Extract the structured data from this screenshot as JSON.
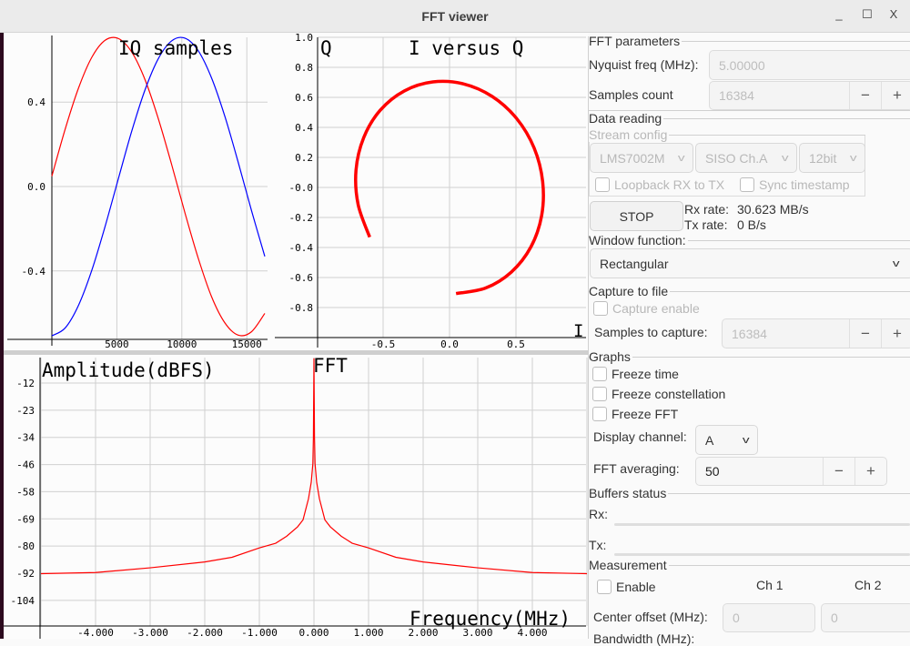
{
  "window": {
    "title": "FFT viewer",
    "minimize": "_",
    "maximize": "☐",
    "close": "X"
  },
  "colors": {
    "i_series": "#ff0000",
    "q_series": "#0000ff",
    "fft": "#ff0000",
    "grid": "#d0d0d0"
  },
  "chart_data": [
    {
      "type": "line",
      "title": "IQ samples",
      "xlabel": "",
      "ylabel": "",
      "xlim": [
        0,
        16384
      ],
      "ylim": [
        -0.72,
        0.71
      ],
      "xticks": [
        5000,
        10000,
        15000
      ],
      "xtick_labels": [
        "5000",
        "10000",
        "15000"
      ],
      "yticks": [
        0.4,
        0.0,
        -0.4
      ],
      "ytick_labels": [
        "0.4",
        "0.0",
        "-0.4"
      ],
      "grid": true,
      "x": [
        0,
        1024,
        2048,
        3072,
        4096,
        5120,
        6144,
        7168,
        8192,
        9216,
        10240,
        11264,
        12288,
        13312,
        14336,
        15360,
        16384
      ],
      "series": [
        {
          "name": "I",
          "color": "#ff0000",
          "values": [
            0.049,
            0.272,
            0.466,
            0.612,
            0.693,
            0.701,
            0.637,
            0.506,
            0.321,
            0.104,
            -0.125,
            -0.34,
            -0.522,
            -0.646,
            -0.704,
            -0.688,
            -0.601
          ]
        },
        {
          "name": "Q",
          "color": "#0000ff",
          "values": [
            -0.707,
            -0.67,
            -0.563,
            -0.397,
            -0.189,
            0.038,
            0.262,
            0.458,
            0.606,
            0.69,
            0.703,
            0.643,
            0.514,
            0.332,
            0.115,
            -0.114,
            -0.331
          ]
        }
      ]
    },
    {
      "type": "scatter",
      "title": "I versus Q",
      "xlabel": "I",
      "ylabel": "Q",
      "xlim": [
        -1.0,
        1.0
      ],
      "ylim": [
        -1.0,
        1.0
      ],
      "xticks": [
        -0.5,
        0.0,
        0.5
      ],
      "xtick_labels": [
        "-0.5",
        "0.0",
        "0.5"
      ],
      "yticks": [
        1.0,
        0.8,
        0.6,
        0.4,
        0.2,
        0.0,
        -0.2,
        -0.4,
        -0.6,
        -0.8
      ],
      "ytick_labels": [
        "1.0",
        "0.8",
        "0.6",
        "0.4",
        "0.2",
        "-0.0",
        "-0.2",
        "-0.4",
        "-0.6",
        "-0.8"
      ],
      "grid": true,
      "source": "IQ samples I/Q series"
    },
    {
      "type": "line",
      "title": "FFT",
      "xlabel": "Frequency(MHz)",
      "ylabel": "Amplitude(dBFS)",
      "xlim": [
        -5,
        5
      ],
      "ylim": [
        -116,
        0
      ],
      "xticks": [
        -4,
        -3,
        -2,
        -1,
        0,
        1,
        2,
        3,
        4
      ],
      "xtick_labels": [
        "-4.000",
        "-3.000",
        "-2.000",
        "-1.000",
        "0.000",
        "1.000",
        "2.000",
        "3.000",
        "4.000"
      ],
      "yticks": [
        -11.6,
        -23.2,
        -34.8,
        -46.4,
        -58,
        -69.6,
        -81.2,
        -92.8,
        -104.4
      ],
      "ytick_labels": [
        "-12",
        "-23",
        "-34",
        "-46",
        "-58",
        "-69",
        "-80",
        "-92",
        "-104"
      ],
      "grid": true,
      "x": [
        -5,
        -4,
        -3,
        -2,
        -1.5,
        -1,
        -0.7,
        -0.5,
        -0.3,
        -0.2,
        -0.1,
        -0.05,
        -0.02,
        -0.01,
        0,
        0.01,
        0.02,
        0.05,
        0.1,
        0.2,
        0.3,
        0.5,
        0.7,
        1,
        1.5,
        2,
        3,
        4,
        5
      ],
      "values": [
        -93,
        -92.5,
        -90.5,
        -88,
        -86,
        -82,
        -80,
        -77,
        -73,
        -70,
        -61,
        -54,
        -46,
        -35,
        -1,
        -35,
        -46,
        -54,
        -61,
        -70,
        -73,
        -77,
        -80,
        -82,
        -86,
        -88,
        -90.5,
        -92.5,
        -93
      ]
    }
  ],
  "panel": {
    "fft_params": {
      "title": "FFT parameters",
      "nyquist_label": "Nyquist freq (MHz):",
      "nyquist_value": "5.00000",
      "samples_label": "Samples count",
      "samples_value": "16384",
      "minus": "−",
      "plus": "+"
    },
    "data_reading": {
      "title": "Data reading",
      "stream_config": "Stream config",
      "chip": "LMS7002M",
      "channel": "SISO Ch.A",
      "format": "12bit",
      "loopback": "Loopback RX to TX",
      "sync": "Sync timestamp",
      "stop": "STOP",
      "rx_rate_label": "Rx rate:",
      "rx_rate": "30.623 MB/s",
      "tx_rate_label": "Tx rate:",
      "tx_rate": "0 B/s"
    },
    "window_function": {
      "label": "Window function:",
      "value": "Rectangular"
    },
    "capture": {
      "title": "Capture to file",
      "enable": "Capture enable",
      "samples_label": "Samples to capture:",
      "samples_value": "16384"
    },
    "graphs": {
      "title": "Graphs",
      "freeze_time": "Freeze time",
      "freeze_constellation": "Freeze constellation",
      "freeze_fft": "Freeze FFT",
      "display_channel_label": "Display channel:",
      "display_channel": "A",
      "fft_avg_label": "FFT averaging:",
      "fft_avg": "50"
    },
    "buffers": {
      "title": "Buffers status",
      "rx": "Rx:",
      "tx": "Tx:"
    },
    "measurement": {
      "title": "Measurement",
      "enable": "Enable",
      "ch1": "Ch 1",
      "ch2": "Ch 2",
      "center_label": "Center offset (MHz):",
      "center_ch1": "0",
      "center_ch2": "0",
      "bandwidth_label": "Bandwidth (MHz):"
    }
  }
}
